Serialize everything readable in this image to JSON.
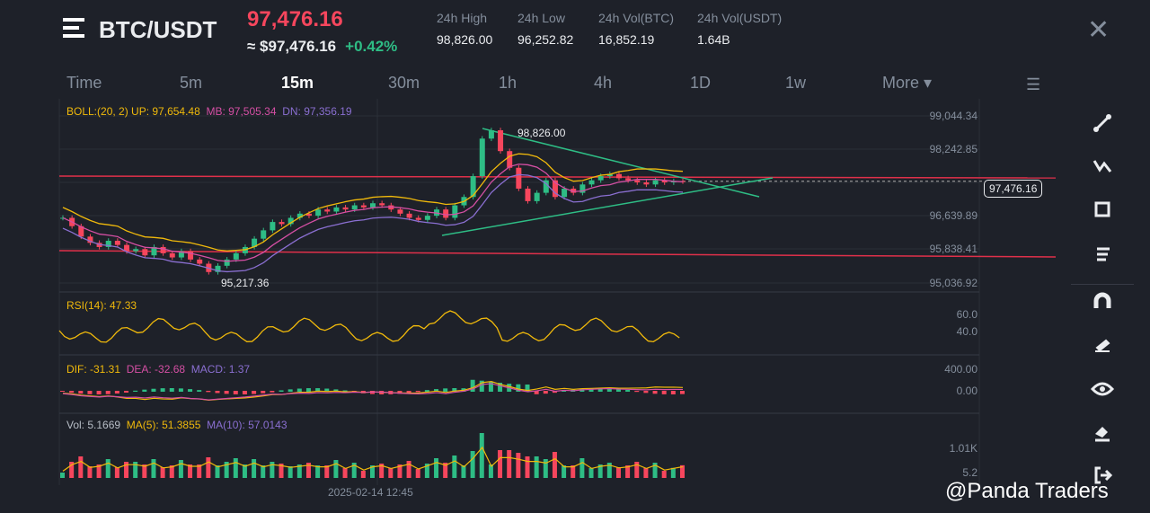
{
  "header": {
    "symbol": "BTC/USDT",
    "last_price": "97,476.16",
    "usd_price": "≈ $97,476.16",
    "change": "+0.42%",
    "stats": [
      {
        "label": "24h High",
        "value": "98,826.00"
      },
      {
        "label": "24h Low",
        "value": "96,252.82"
      },
      {
        "label": "24h Vol(BTC)",
        "value": "16,852.19"
      },
      {
        "label": "24h Vol(USDT)",
        "value": "1.64B"
      }
    ]
  },
  "tabs": [
    "Time",
    "5m",
    "15m",
    "30m",
    "1h",
    "4h",
    "1D",
    "1w",
    "More ▾"
  ],
  "active_tab": "15m",
  "indicators": {
    "boll": "BOLL:(20, 2)",
    "boll_up": "UP: 97,654.48",
    "boll_mb": "MB: 97,505.34",
    "boll_dn": "DN: 97,356.19",
    "rsi": "RSI(14): 47.33",
    "dif": "DIF: -31.31",
    "dea": "DEA: -32.68",
    "macd": "MACD: 1.37",
    "vol": "Vol: 5.1669",
    "ma5": "MA(5): 51.3855",
    "ma10": "MA(10): 57.0143"
  },
  "price_axis": [
    "99,044.34",
    "98,242.85",
    "96,639.89",
    "95,838.41",
    "95,036.92"
  ],
  "current_price_tag": "97,476.16",
  "high_label": "98,826.00",
  "low_label": "95,217.36",
  "rsi_axis": [
    "60.0",
    "40.0"
  ],
  "macd_axis": [
    "400.00",
    "0.00"
  ],
  "vol_axis": [
    "1.01K",
    "5.2"
  ],
  "time_label": "2025-02-14 12:45",
  "watermark": "@Panda Traders",
  "colors": {
    "up": "#2ebd85",
    "down": "#f6465d",
    "boll_up": "#f0b90b",
    "boll_mb": "#d54fa4",
    "boll_dn": "#8a6fd1",
    "trend": "#2ebd85",
    "level": "#e0304a"
  },
  "chart_data": {
    "type": "candlestick",
    "ylim": [
      95036.92,
      99044.34
    ],
    "closes": [
      96600,
      96400,
      96150,
      96000,
      95900,
      96050,
      95950,
      95800,
      95850,
      95700,
      95900,
      95750,
      95650,
      95800,
      95600,
      95500,
      95300,
      95450,
      95600,
      95750,
      95900,
      96100,
      96300,
      96500,
      96450,
      96600,
      96700,
      96650,
      96800,
      96750,
      96850,
      96800,
      96900,
      96850,
      96950,
      96900,
      96800,
      96700,
      96600,
      96550,
      96650,
      96800,
      96600,
      96900,
      97100,
      97600,
      98500,
      98700,
      98200,
      97800,
      97300,
      97000,
      97200,
      97500,
      97100,
      97300,
      97200,
      97400,
      97500,
      97600,
      97650,
      97550,
      97500,
      97450,
      97400,
      97500,
      97450,
      97480,
      97476
    ]
  }
}
